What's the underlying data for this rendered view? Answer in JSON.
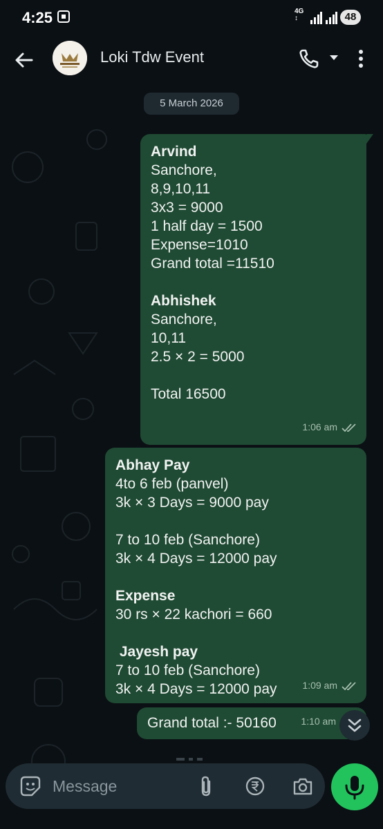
{
  "status": {
    "time": "4:25",
    "network": "4G",
    "battery": "48"
  },
  "header": {
    "contact_name": "Loki Tdw Event",
    "avatar_text": "THE DREAM WEAVERS"
  },
  "chat": {
    "date_chip": "5 March 2026",
    "messages": [
      {
        "title1": "Arvind",
        "body1": "\nSanchore,\n8,9,10,11\n3x3 = 9000\n1 half day = 1500\nExpense=1010\nGrand total =11510\n",
        "title2": "Abhishek",
        "body2": "\nSanchore,\n10,11\n2.5 × 2 = 5000\n\nTotal 16500",
        "time": "1:06 am"
      },
      {
        "title1": "Abhay Pay",
        "body1": "4to 6 feb (panvel)\n3k × 3 Days = 9000 pay\n\n7 to 10 feb (Sanchore)\n3k × 4 Days = 12000 pay\n",
        "title2": "Expense",
        "body2": "30 rs × 22 kachori = 660\n",
        "title3": " Jayesh pay",
        "body3": "7 to 10 feb (Sanchore)\n3k × 4 Days = 12000 pay",
        "time": "1:09 am"
      },
      {
        "body": "Grand total :- 50160",
        "time": "1:10 am"
      }
    ]
  },
  "composer": {
    "placeholder": "Message"
  },
  "colors": {
    "bubble": "#1f4a33",
    "background": "#0b1014",
    "accent": "#22c35d"
  }
}
